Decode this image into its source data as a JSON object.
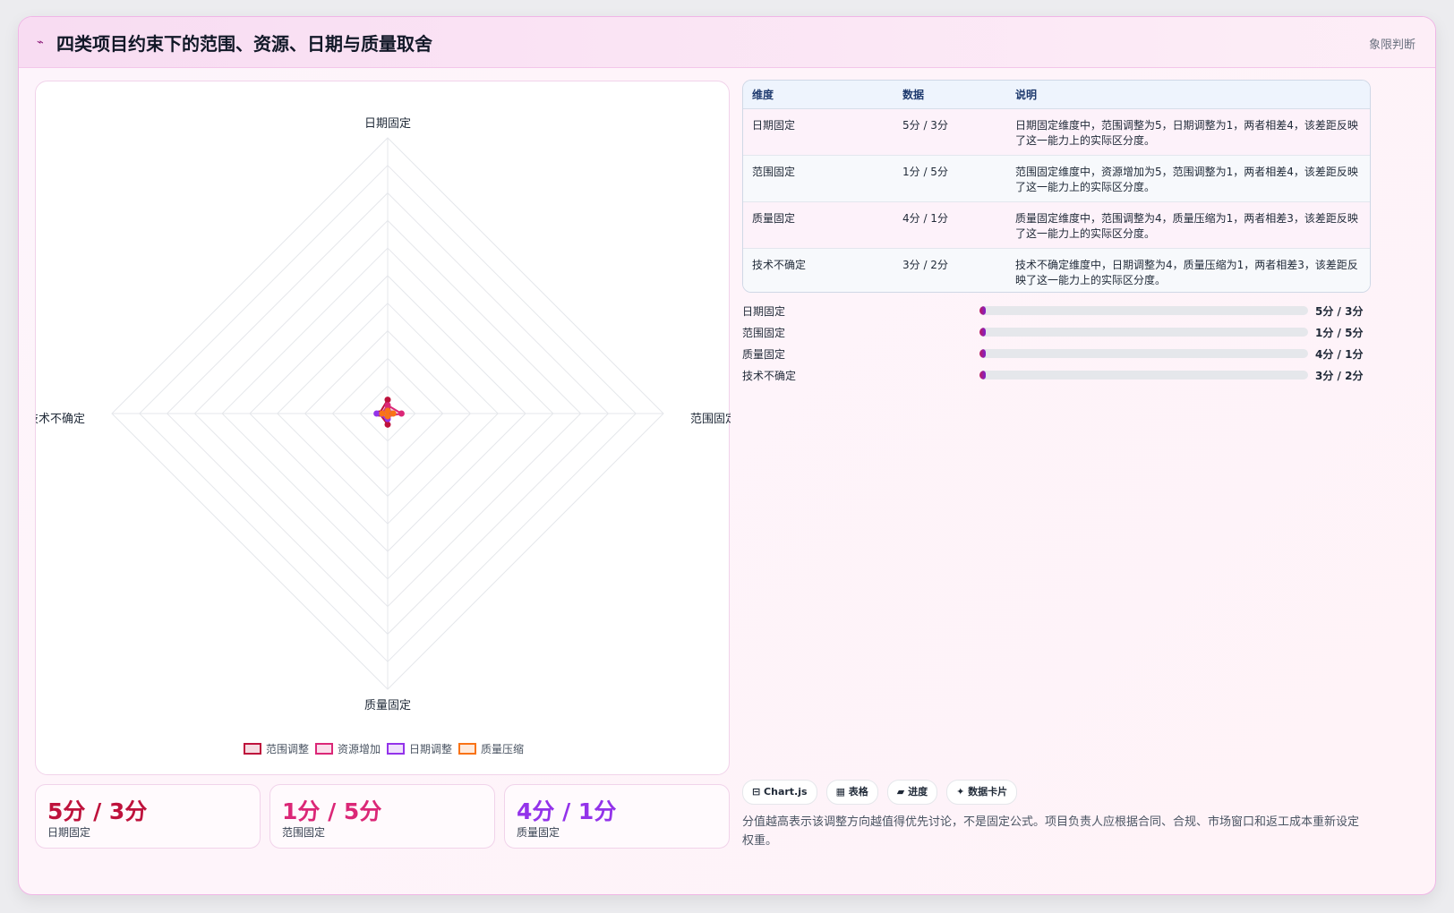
{
  "header": {
    "icon": "trend-icon",
    "title": "四类项目约束下的范围、资源、日期与质量取舍",
    "tag": "象限判断"
  },
  "chart_data": {
    "type": "radar",
    "axes": [
      "日期固定",
      "范围固定",
      "质量固定",
      "技术不确定"
    ],
    "series": [
      {
        "name": "范围调整",
        "values": [
          5,
          1,
          4,
          3
        ],
        "color": "#be123c"
      },
      {
        "name": "资源增加",
        "values": [
          3,
          5,
          1,
          2
        ],
        "color": "#db2777"
      },
      {
        "name": "日期调整",
        "values": [
          1,
          1,
          2,
          4
        ],
        "color": "#9333ea"
      },
      {
        "name": "质量压缩",
        "values": [
          1,
          2,
          1,
          2
        ],
        "color": "#f97316"
      }
    ],
    "r_range": [
      0,
      100
    ],
    "grid": true,
    "legend_position": "bottom"
  },
  "kpis": [
    {
      "value": "5分 / 3分",
      "label": "日期固定",
      "color": "#be123c"
    },
    {
      "value": "1分 / 5分",
      "label": "范围固定",
      "color": "#db2777"
    },
    {
      "value": "4分 / 1分",
      "label": "质量固定",
      "color": "#9333ea"
    }
  ],
  "table": {
    "headers": [
      "维度",
      "数据",
      "说明"
    ],
    "rows": [
      [
        "日期固定",
        "5分 / 3分",
        "日期固定维度中，范围调整为5，日期调整为1，两者相差4，该差距反映了这一能力上的实际区分度。"
      ],
      [
        "范围固定",
        "1分 / 5分",
        "范围固定维度中，资源增加为5，范围调整为1，两者相差4，该差距反映了这一能力上的实际区分度。"
      ],
      [
        "质量固定",
        "4分 / 1分",
        "质量固定维度中，范围调整为4，质量压缩为1，两者相差3，该差距反映了这一能力上的实际区分度。"
      ],
      [
        "技术不确定",
        "3分 / 2分",
        "技术不确定维度中，日期调整为4，质量压缩为1，两者相差3，该差距反映了这一能力上的实际区分度。"
      ]
    ]
  },
  "progress": [
    {
      "label": "日期固定",
      "value": "5分 / 3分",
      "fraction": 0.02
    },
    {
      "label": "范围固定",
      "value": "1分 / 5分",
      "fraction": 0.02
    },
    {
      "label": "质量固定",
      "value": "4分 / 1分",
      "fraction": 0.02
    },
    {
      "label": "技术不确定",
      "value": "3分 / 2分",
      "fraction": 0.02
    }
  ],
  "chips": [
    "⊟ Chart.js",
    "▦ 表格",
    "▰ 进度",
    "✦ 数据卡片"
  ],
  "note": "分值越高表示该调整方向越值得优先讨论，不是固定公式。项目负责人应根据合同、合规、市场窗口和返工成本重新设定权重。"
}
